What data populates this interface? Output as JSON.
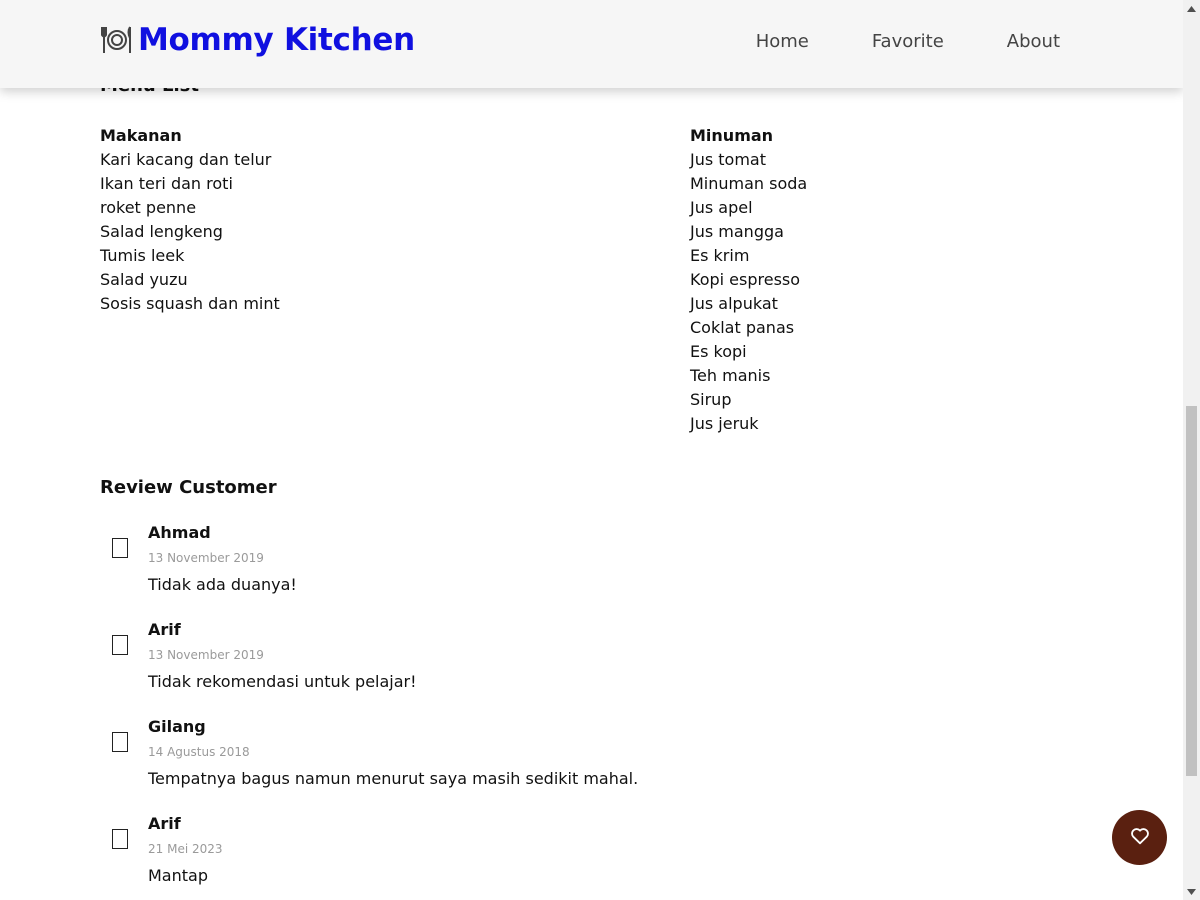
{
  "header": {
    "brand_title": "Mommy Kitchen",
    "nav": [
      "Home",
      "Favorite",
      "About"
    ]
  },
  "menu": {
    "title": "Menu List",
    "food": {
      "heading": "Makanan",
      "items": [
        "Kari kacang dan telur",
        "Ikan teri dan roti",
        "roket penne",
        "Salad lengkeng",
        "Tumis leek",
        "Salad yuzu",
        "Sosis squash dan mint"
      ]
    },
    "drink": {
      "heading": "Minuman",
      "items": [
        "Jus tomat",
        "Minuman soda",
        "Jus apel",
        "Jus mangga",
        "Es krim",
        "Kopi espresso",
        "Jus alpukat",
        "Coklat panas",
        "Es kopi",
        "Teh manis",
        "Sirup",
        "Jus jeruk"
      ]
    }
  },
  "reviews": {
    "title": "Review Customer",
    "items": [
      {
        "name": "Ahmad",
        "date": "13 November 2019",
        "text": "Tidak ada duanya!"
      },
      {
        "name": "Arif",
        "date": "13 November 2019",
        "text": "Tidak rekomendasi untuk pelajar!"
      },
      {
        "name": "Gilang",
        "date": "14 Agustus 2018",
        "text": "Tempatnya bagus namun menurut saya masih sedikit mahal."
      },
      {
        "name": "Arif",
        "date": "21 Mei 2023",
        "text": "Mantap"
      }
    ]
  },
  "colors": {
    "brand": "#1010e0",
    "fab": "#5a2010",
    "nav_bg": "#f6f6f6"
  },
  "icons": {
    "brand": "plate-cutlery-icon",
    "review": "missing-glyph-icon",
    "fab": "heart-icon"
  }
}
